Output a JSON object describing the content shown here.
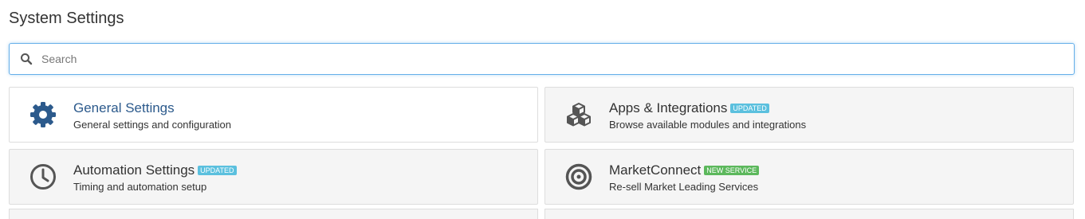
{
  "page": {
    "title": "System Settings"
  },
  "search": {
    "placeholder": "Search",
    "value": ""
  },
  "cards": [
    {
      "title": "General Settings",
      "description": "General settings and configuration",
      "icon": "gear-icon",
      "badge": ""
    },
    {
      "title": "Apps & Integrations",
      "description": "Browse available modules and integrations",
      "icon": "cubes-icon",
      "badge": "UPDATED"
    },
    {
      "title": "Automation Settings",
      "description": "Timing and automation setup",
      "icon": "clock-icon",
      "badge": "UPDATED"
    },
    {
      "title": "MarketConnect",
      "description": "Re-sell Market Leading Services",
      "icon": "bullseye-icon",
      "badge": "NEW SERVICE"
    }
  ],
  "colors": {
    "title_link": "#2c5a8c",
    "icon": "#555555",
    "general_icon": "#2c5a8c",
    "badge_updated": "#5bc0de",
    "badge_new": "#5cb85c",
    "search_focus": "#66afe9"
  }
}
